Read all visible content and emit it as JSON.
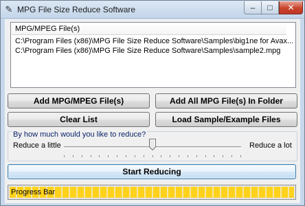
{
  "window": {
    "title": "MPG File Size Reduce Software",
    "minimize_glyph": "–",
    "maximize_glyph": "□",
    "close_glyph": "✕"
  },
  "file_list": {
    "header": "MPG/MPEG File(s)",
    "rows": [
      "C:\\Program Files (x86)\\MPG File Size Reduce Software\\Samples\\big1ne for Avax...",
      "C:\\Program Files (x86)\\MPG File Size Reduce Software\\Samples\\sample2.mpg"
    ]
  },
  "buttons": {
    "add_files": "Add MPG/MPEG File(s)",
    "add_folder": "Add All MPG File(s) In Folder",
    "clear_list": "Clear List",
    "load_sample": "Load Sample/Example Files",
    "start": "Start Reducing"
  },
  "reduction": {
    "legend": "By how much would you like to reduce?",
    "min_label": "Reduce a little",
    "max_label": "Reduce a lot",
    "level": 0.5,
    "tick_count": 21
  },
  "progress": {
    "label": "Progress Bar",
    "fill": 1.0
  },
  "colors": {
    "window_frame": "#c7d8ec",
    "progress_fill": "#ffd21c",
    "close_button": "#c8432a"
  }
}
